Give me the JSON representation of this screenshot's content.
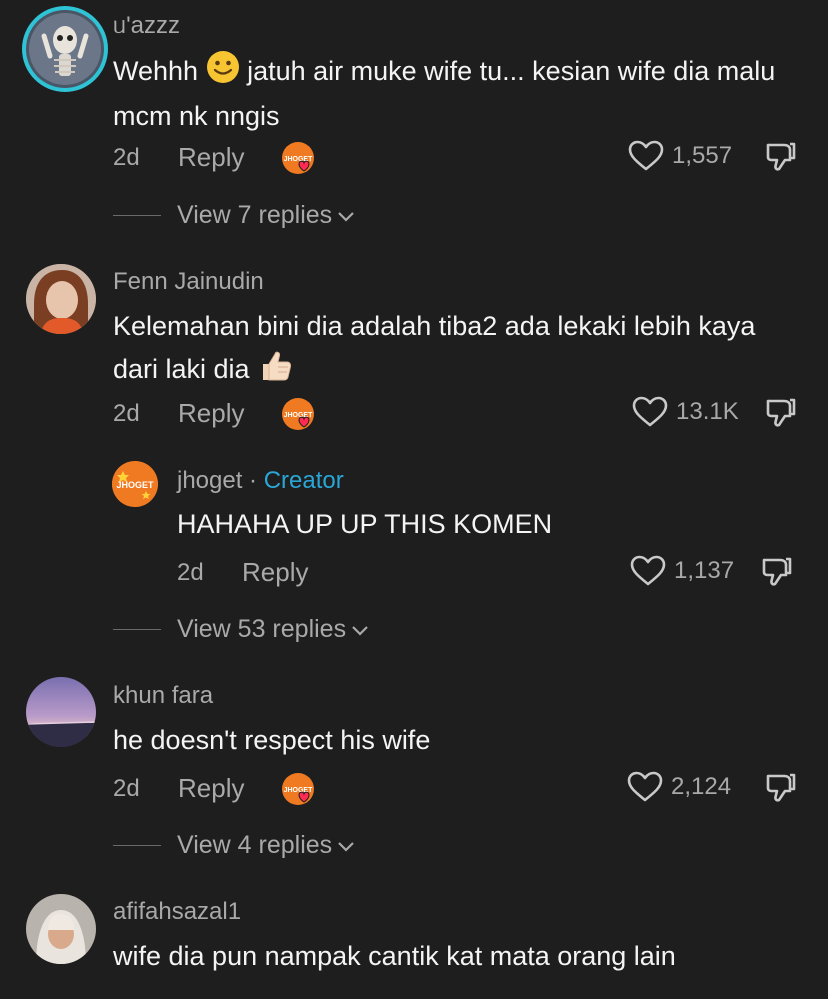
{
  "comments": [
    {
      "username": "ᥙ'azzz",
      "text_before": "Wehhh ",
      "text_after": " jatuh air muke wife tu... kesian wife dia malu mcm nk nngis",
      "emoji": "slightly-smiling-face",
      "time": "2d",
      "reply_label": "Reply",
      "likes": "1,557",
      "view_replies": "View 7 replies"
    },
    {
      "username": "Fenn Jainudin",
      "text_before": "Kelemahan bini dia adalah tiba2 ada lekaki lebih kaya dari laki dia ",
      "emoji": "thumbs-up",
      "time": "2d",
      "reply_label": "Reply",
      "likes": "13.1K"
    },
    {
      "username": "jhoget",
      "sep": " · ",
      "creator_label": "Creator",
      "text": "HAHAHA UP UP THIS KOMEN",
      "time": "2d",
      "reply_label": "Reply",
      "likes": "1,137",
      "view_replies": "View 53 replies"
    },
    {
      "username": "khun fara",
      "text": "he doesn't respect his wife",
      "time": "2d",
      "reply_label": "Reply",
      "likes": "2,124",
      "view_replies": "View 4 replies"
    },
    {
      "username": "afifahsazal1",
      "text": "wife dia pun nampak cantik kat mata orang lain"
    }
  ],
  "badge_text": "JHOGET",
  "colors": {
    "background": "#1e1e1e",
    "text": "#f4f4f4",
    "muted": "#a9a9a9",
    "creator": "#2aa6d6",
    "badge_orange": "#f07a22",
    "heart_red": "#ff2b55"
  }
}
